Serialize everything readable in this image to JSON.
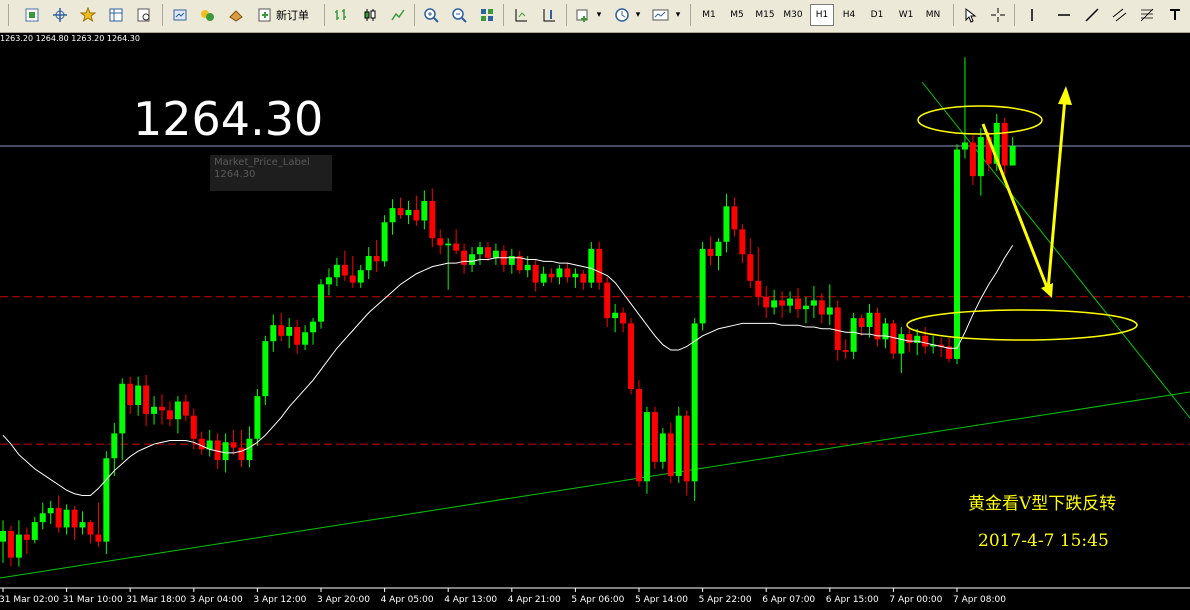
{
  "toolbar": {
    "new_order_label": "新订单",
    "timeframes": [
      "M1",
      "M5",
      "M15",
      "M30",
      "H1",
      "H4",
      "D1",
      "W1",
      "MN"
    ],
    "active_timeframe": "H1",
    "icons": [
      "new-chart-icon",
      "profiles-icon",
      "crosshair-icon",
      "favorites-icon",
      "market-watch-icon",
      "navigator-icon",
      "terminal-icon",
      "strategy-tester-icon",
      "autotrading-icon",
      "new-order-icon",
      "bar-chart-icon",
      "candlestick-icon",
      "line-chart-icon",
      "zoom-in-icon",
      "zoom-out-icon",
      "tile-windows-icon",
      "autoscroll-icon",
      "chart-shift-icon",
      "indicators-icon",
      "periods-icon",
      "templates-icon",
      "cursor-icon",
      "crosshair-tool-icon",
      "vertical-line-icon",
      "horizontal-line-icon",
      "trendline-icon",
      "equidistant-channel-icon",
      "fibonacci-icon",
      "text-icon"
    ]
  },
  "ohlc_text": "1263.20 1264.80 1263.20 1264.30",
  "big_price": "1264.30",
  "price_label": {
    "name": "Market_Price_Label",
    "value": "1264.30"
  },
  "annotation": {
    "title": "黄金看V型下跌反转",
    "datetime": "2017-4-7   15:45"
  },
  "colors": {
    "background": "#000000",
    "bull": "#00ff00",
    "bear": "#ff0000",
    "ma": "#ffffff",
    "price_line": "#8c9bc8",
    "support_line": "#cc0000",
    "trendline": "#00c800",
    "annotation": "#ffff00"
  },
  "chart_data": {
    "type": "candlestick",
    "title": "",
    "x_tick_labels": [
      "31 Mar 02:00",
      "31 Mar 10:00",
      "31 Mar 18:00",
      "3 Apr 04:00",
      "3 Apr 12:00",
      "3 Apr 20:00",
      "4 Apr 05:00",
      "4 Apr 13:00",
      "4 Apr 21:00",
      "5 Apr 06:00",
      "5 Apr 14:00",
      "5 Apr 22:00",
      "6 Apr 07:00",
      "6 Apr 15:00",
      "7 Apr 00:00",
      "7 Apr 08:00"
    ],
    "x_tick_index": [
      0,
      8,
      16,
      24,
      32,
      40,
      48,
      56,
      64,
      72,
      80,
      88,
      96,
      104,
      112,
      120
    ],
    "y_range": [
      1239.5,
      1270.5
    ],
    "last_price": 1264.3,
    "horizontal_levels": [
      1255.8,
      1247.5
    ],
    "candles": [
      [
        1242.0,
        1243.2,
        1240.8,
        1242.6
      ],
      [
        1242.6,
        1242.9,
        1240.6,
        1241.1
      ],
      [
        1241.1,
        1243.2,
        1240.6,
        1242.4
      ],
      [
        1242.4,
        1242.8,
        1241.3,
        1242.1
      ],
      [
        1242.1,
        1243.4,
        1241.9,
        1243.1
      ],
      [
        1243.1,
        1244.2,
        1242.7,
        1243.6
      ],
      [
        1243.6,
        1244.3,
        1243.0,
        1243.9
      ],
      [
        1243.9,
        1244.6,
        1242.5,
        1242.8
      ],
      [
        1242.8,
        1244.1,
        1242.4,
        1243.8
      ],
      [
        1243.8,
        1244.0,
        1242.1,
        1242.8
      ],
      [
        1242.8,
        1243.7,
        1242.4,
        1243.1
      ],
      [
        1243.1,
        1243.2,
        1241.9,
        1242.4
      ],
      [
        1242.4,
        1244.2,
        1241.7,
        1242.0
      ],
      [
        1242.0,
        1247.1,
        1241.3,
        1246.7
      ],
      [
        1246.7,
        1248.7,
        1245.7,
        1248.1
      ],
      [
        1248.1,
        1251.2,
        1246.6,
        1250.9
      ],
      [
        1250.9,
        1251.3,
        1249.2,
        1249.7
      ],
      [
        1249.7,
        1251.3,
        1249.1,
        1250.8
      ],
      [
        1250.8,
        1251.4,
        1248.5,
        1249.2
      ],
      [
        1249.2,
        1250.2,
        1248.6,
        1249.6
      ],
      [
        1249.6,
        1250.3,
        1248.6,
        1249.4
      ],
      [
        1249.4,
        1249.9,
        1248.5,
        1248.9
      ],
      [
        1248.9,
        1250.2,
        1248.1,
        1249.9
      ],
      [
        1249.9,
        1250.3,
        1248.8,
        1249.1
      ],
      [
        1249.1,
        1249.5,
        1247.2,
        1247.8
      ],
      [
        1247.8,
        1248.2,
        1246.9,
        1247.2
      ],
      [
        1247.2,
        1248.3,
        1246.8,
        1247.7
      ],
      [
        1247.7,
        1248.1,
        1246.1,
        1246.6
      ],
      [
        1246.6,
        1248.1,
        1245.9,
        1247.6
      ],
      [
        1247.6,
        1248.3,
        1246.9,
        1247.3
      ],
      [
        1247.3,
        1248.3,
        1246.2,
        1246.6
      ],
      [
        1246.6,
        1248.5,
        1246.2,
        1247.8
      ],
      [
        1247.8,
        1250.6,
        1247.4,
        1250.2
      ],
      [
        1250.2,
        1253.6,
        1249.7,
        1253.3
      ],
      [
        1253.3,
        1254.8,
        1252.7,
        1254.2
      ],
      [
        1254.2,
        1254.9,
        1253.3,
        1253.6
      ],
      [
        1253.6,
        1254.6,
        1252.9,
        1254.1
      ],
      [
        1254.1,
        1254.5,
        1252.6,
        1253.1
      ],
      [
        1253.1,
        1254.2,
        1252.8,
        1253.8
      ],
      [
        1253.8,
        1254.6,
        1253.1,
        1254.4
      ],
      [
        1254.4,
        1256.8,
        1254.0,
        1256.5
      ],
      [
        1256.5,
        1257.4,
        1255.9,
        1256.9
      ],
      [
        1256.9,
        1258.0,
        1256.4,
        1257.6
      ],
      [
        1257.6,
        1258.4,
        1256.7,
        1257.0
      ],
      [
        1257.0,
        1258.1,
        1256.3,
        1256.6
      ],
      [
        1256.6,
        1257.6,
        1256.3,
        1257.3
      ],
      [
        1257.3,
        1258.6,
        1256.8,
        1258.1
      ],
      [
        1258.1,
        1259.0,
        1257.2,
        1257.8
      ],
      [
        1257.8,
        1260.4,
        1257.5,
        1260.0
      ],
      [
        1260.0,
        1261.3,
        1259.3,
        1260.8
      ],
      [
        1260.8,
        1261.4,
        1260.2,
        1260.4
      ],
      [
        1260.4,
        1261.2,
        1259.9,
        1260.7
      ],
      [
        1260.7,
        1261.5,
        1259.8,
        1260.1
      ],
      [
        1260.1,
        1261.8,
        1259.6,
        1261.2
      ],
      [
        1261.2,
        1261.9,
        1258.6,
        1259.1
      ],
      [
        1259.1,
        1259.6,
        1258.2,
        1258.7
      ],
      [
        1258.7,
        1259.1,
        1256.2,
        1258.8
      ],
      [
        1258.8,
        1259.6,
        1258.2,
        1258.4
      ],
      [
        1258.4,
        1258.8,
        1257.1,
        1257.6
      ],
      [
        1257.6,
        1258.6,
        1257.2,
        1258.2
      ],
      [
        1258.2,
        1258.9,
        1257.6,
        1258.6
      ],
      [
        1258.6,
        1258.9,
        1257.8,
        1258.0
      ],
      [
        1258.0,
        1258.8,
        1257.6,
        1258.4
      ],
      [
        1258.4,
        1258.7,
        1257.2,
        1257.6
      ],
      [
        1257.6,
        1258.5,
        1257.1,
        1258.1
      ],
      [
        1258.1,
        1258.4,
        1257.1,
        1257.3
      ],
      [
        1257.3,
        1258.1,
        1256.9,
        1257.6
      ],
      [
        1257.6,
        1257.9,
        1256.1,
        1256.6
      ],
      [
        1256.6,
        1257.5,
        1256.4,
        1257.1
      ],
      [
        1257.1,
        1257.4,
        1256.6,
        1256.9
      ],
      [
        1256.9,
        1257.6,
        1256.5,
        1257.4
      ],
      [
        1257.4,
        1257.7,
        1256.6,
        1256.9
      ],
      [
        1256.9,
        1257.4,
        1256.3,
        1257.1
      ],
      [
        1257.1,
        1257.3,
        1256.2,
        1256.6
      ],
      [
        1256.6,
        1258.9,
        1256.3,
        1258.5
      ],
      [
        1258.5,
        1258.9,
        1256.2,
        1256.6
      ],
      [
        1256.6,
        1256.9,
        1254.1,
        1254.6
      ],
      [
        1254.6,
        1255.4,
        1253.8,
        1254.9
      ],
      [
        1254.9,
        1255.2,
        1253.8,
        1254.3
      ],
      [
        1254.3,
        1254.6,
        1250.3,
        1250.6
      ],
      [
        1250.6,
        1251.1,
        1245.1,
        1245.4
      ],
      [
        1245.4,
        1249.6,
        1244.7,
        1249.3
      ],
      [
        1249.3,
        1249.6,
        1246.1,
        1246.5
      ],
      [
        1246.5,
        1248.4,
        1246.1,
        1248.1
      ],
      [
        1248.1,
        1248.7,
        1245.3,
        1245.7
      ],
      [
        1245.7,
        1249.6,
        1245.3,
        1249.1
      ],
      [
        1249.1,
        1249.4,
        1244.6,
        1245.4
      ],
      [
        1245.4,
        1254.6,
        1244.3,
        1254.3
      ],
      [
        1254.3,
        1258.9,
        1253.9,
        1258.5
      ],
      [
        1258.5,
        1259.2,
        1257.6,
        1258.1
      ],
      [
        1258.1,
        1259.1,
        1257.3,
        1258.9
      ],
      [
        1258.9,
        1261.6,
        1258.3,
        1260.9
      ],
      [
        1260.9,
        1261.4,
        1259.2,
        1259.6
      ],
      [
        1259.6,
        1259.9,
        1257.7,
        1258.2
      ],
      [
        1258.2,
        1259.1,
        1256.3,
        1256.7
      ],
      [
        1256.7,
        1258.6,
        1255.3,
        1255.8
      ],
      [
        1255.8,
        1256.4,
        1254.6,
        1255.2
      ],
      [
        1255.2,
        1256.2,
        1254.8,
        1255.6
      ],
      [
        1255.6,
        1256.1,
        1254.6,
        1255.3
      ],
      [
        1255.3,
        1256.1,
        1254.9,
        1255.7
      ],
      [
        1255.7,
        1256.3,
        1254.6,
        1255.1
      ],
      [
        1255.1,
        1255.8,
        1254.3,
        1255.3
      ],
      [
        1255.3,
        1256.4,
        1254.6,
        1255.6
      ],
      [
        1255.6,
        1256.0,
        1254.3,
        1254.8
      ],
      [
        1254.8,
        1256.5,
        1254.2,
        1255.2
      ],
      [
        1255.2,
        1255.6,
        1252.2,
        1252.8
      ],
      [
        1252.8,
        1253.4,
        1252.3,
        1252.7
      ],
      [
        1252.7,
        1254.9,
        1252.3,
        1254.6
      ],
      [
        1254.6,
        1254.8,
        1253.6,
        1254.1
      ],
      [
        1254.1,
        1255.4,
        1253.5,
        1254.9
      ],
      [
        1254.9,
        1255.2,
        1253.0,
        1253.4
      ],
      [
        1253.4,
        1254.6,
        1252.9,
        1254.3
      ],
      [
        1254.3,
        1254.5,
        1252.3,
        1252.6
      ],
      [
        1252.6,
        1254.1,
        1251.5,
        1253.7
      ],
      [
        1253.7,
        1254.1,
        1252.7,
        1253.2
      ],
      [
        1253.2,
        1254.0,
        1252.5,
        1253.6
      ],
      [
        1253.6,
        1254.1,
        1252.6,
        1253.0
      ],
      [
        1253.0,
        1253.6,
        1252.6,
        1253.1
      ],
      [
        1253.1,
        1253.5,
        1252.4,
        1253.0
      ],
      [
        1253.0,
        1253.5,
        1252.1,
        1252.3
      ],
      [
        1252.3,
        1264.4,
        1252.0,
        1264.1
      ],
      [
        1264.1,
        1269.3,
        1263.6,
        1264.5
      ],
      [
        1264.5,
        1264.9,
        1262.1,
        1262.6
      ],
      [
        1262.6,
        1265.3,
        1261.5,
        1264.8
      ],
      [
        1264.8,
        1265.1,
        1262.9,
        1263.3
      ],
      [
        1263.3,
        1266.1,
        1262.9,
        1265.6
      ],
      [
        1265.6,
        1265.9,
        1262.7,
        1263.2
      ],
      [
        1263.2,
        1264.8,
        1263.2,
        1264.3
      ]
    ],
    "moving_average": {
      "name": "",
      "values": [
        1248.0,
        1247.5,
        1246.9,
        1246.5,
        1246.1,
        1245.8,
        1245.5,
        1245.2,
        1244.9,
        1244.7,
        1244.6,
        1244.6,
        1245.0,
        1245.5,
        1246.0,
        1246.4,
        1246.8,
        1247.1,
        1247.3,
        1247.5,
        1247.6,
        1247.7,
        1247.7,
        1247.7,
        1247.6,
        1247.4,
        1247.2,
        1247.1,
        1247.0,
        1247.0,
        1247.1,
        1247.3,
        1247.6,
        1248.0,
        1248.5,
        1249.0,
        1249.6,
        1250.1,
        1250.6,
        1251.1,
        1251.7,
        1252.3,
        1252.9,
        1253.4,
        1253.9,
        1254.4,
        1254.9,
        1255.3,
        1255.7,
        1256.1,
        1256.5,
        1256.8,
        1257.1,
        1257.3,
        1257.5,
        1257.6,
        1257.7,
        1257.7,
        1257.8,
        1257.8,
        1257.9,
        1257.9,
        1258.0,
        1258.0,
        1258.0,
        1258.0,
        1257.9,
        1257.9,
        1257.8,
        1257.8,
        1257.7,
        1257.7,
        1257.6,
        1257.5,
        1257.4,
        1257.2,
        1257.0,
        1256.6,
        1256.0,
        1255.4,
        1254.8,
        1254.2,
        1253.6,
        1253.1,
        1252.8,
        1252.8,
        1253.0,
        1253.3,
        1253.6,
        1253.8,
        1254.0,
        1254.1,
        1254.2,
        1254.3,
        1254.3,
        1254.3,
        1254.3,
        1254.3,
        1254.2,
        1254.2,
        1254.2,
        1254.1,
        1254.1,
        1254.0,
        1254.0,
        1253.9,
        1253.8,
        1253.8,
        1253.7,
        1253.7,
        1253.6,
        1253.6,
        1253.5,
        1253.4,
        1253.3,
        1253.3,
        1253.2,
        1253.1,
        1253.0,
        1252.9,
        1252.9,
        1253.8,
        1254.8,
        1255.7,
        1256.5,
        1257.2,
        1258.0,
        1258.7
      ]
    }
  }
}
